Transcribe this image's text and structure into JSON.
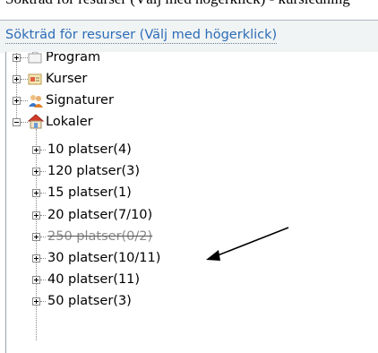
{
  "document": {
    "cropped_caption": "Sökträd för resurser (Välj med högerklick) - kursledning"
  },
  "panel": {
    "title": "Sökträd för resurser (Välj med högerklick)"
  },
  "tree": {
    "top_nodes": [
      {
        "label": "Program",
        "icon": "program-folder-icon",
        "expanded": false
      },
      {
        "label": "Kurser",
        "icon": "course-icon",
        "expanded": false
      },
      {
        "label": "Signaturer",
        "icon": "users-icon",
        "expanded": false
      },
      {
        "label": "Lokaler",
        "icon": "house-icon",
        "expanded": true
      }
    ],
    "children": [
      {
        "label": "10 platser(4)",
        "struck": false
      },
      {
        "label": "120 platser(3)",
        "struck": false
      },
      {
        "label": "15 platser(1)",
        "struck": false
      },
      {
        "label": "20 platser(7/10)",
        "struck": false
      },
      {
        "label": "250 platser(0/2)",
        "struck": true
      },
      {
        "label": "30 platser(10/11)",
        "struck": false
      },
      {
        "label": "40 platser(11)",
        "struck": false
      },
      {
        "label": "50 platser(3)",
        "struck": false
      }
    ]
  },
  "colors": {
    "panel_title": "#2b6cb8",
    "panel_bg": "#f1f4f4",
    "struck_text": "#8a8a8a",
    "house_roof": "#d23a2a"
  }
}
